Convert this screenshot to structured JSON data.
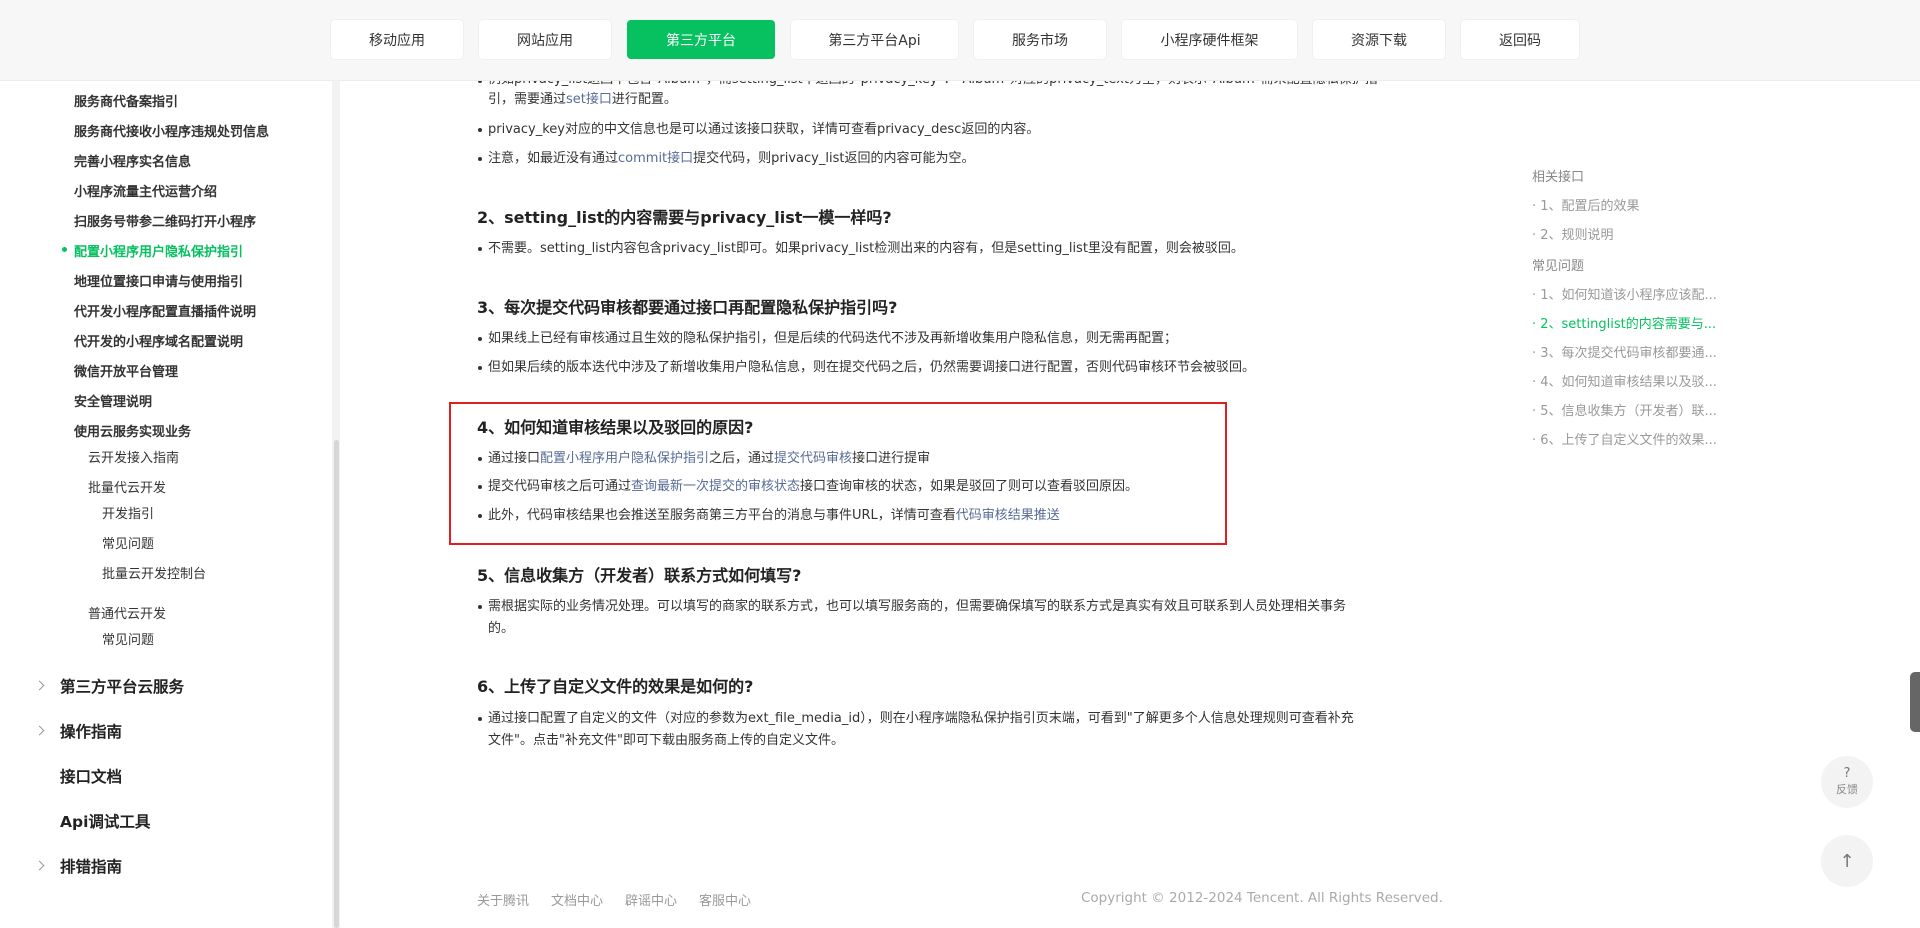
{
  "topnav": {
    "items": [
      "移动应用",
      "网站应用",
      "第三方平台",
      "第三方平台Api",
      "服务市场",
      "小程序硬件框架",
      "资源下载",
      "返回码"
    ],
    "active_index": 2
  },
  "sidebar": {
    "items": [
      "服务商代备案指引",
      "服务商代接收小程序违规处罚信息",
      "完善小程序实名信息",
      "小程序流量主代运营介绍",
      "扫服务号带参二维码打开小程序",
      "配置小程序用户隐私保护指引",
      "地理位置接口申请与使用指引",
      "代开发小程序配置直播插件说明",
      "代开发的小程序域名配置说明",
      "微信开放平台管理",
      "安全管理说明",
      "使用云服务实现业务"
    ],
    "active_item": "配置小程序用户隐私保护指引",
    "cloud_sub": {
      "access_guide": "云开发接入指南",
      "batch": "批量代云开发",
      "batch_children": [
        "开发指引",
        "常见问题",
        "批量云开发控制台"
      ],
      "normal": "普通代云开发",
      "normal_children": [
        "常见问题"
      ]
    },
    "top_sections": [
      "第三方平台云服务",
      "操作指南",
      "接口文档",
      "Api调试工具",
      "排错指南"
    ]
  },
  "content": {
    "intro_line1_a": "例如privacy_list返回中包含\"Album\"，而setting_list中返回的\"privacy_key\"：\"Album\"对应的privacy_text为空，则表示\"Album\"需未配置隐私保护指",
    "intro_line2_a": "引，需要通过",
    "intro_line2_link": "set接口",
    "intro_line2_b": "进行配置。",
    "intro_b2": "privacy_key对应的中文信息也是可以通过该接口获取，详情可查看privacy_desc返回的内容。",
    "intro_b3_a": "注意，如最近没有通过",
    "intro_b3_link": "commit接口",
    "intro_b3_b": "提交代码，则privacy_list返回的内容可能为空。",
    "q2_title": "2、setting_list的内容需要与privacy_list一模一样吗?",
    "q2_b1": "不需要。setting_list内容包含privacy_list即可。如果privacy_list检测出来的内容有，但是setting_list里没有配置，则会被驳回。",
    "q3_title": "3、每次提交代码审核都要通过接口再配置隐私保护指引吗?",
    "q3_b1": "如果线上已经有审核通过且生效的隐私保护指引，但是后续的代码迭代不涉及再新增收集用户隐私信息，则无需再配置；",
    "q3_b2": "但如果后续的版本迭代中涉及了新增收集用户隐私信息，则在提交代码之后，仍然需要调接口进行配置，否则代码审核环节会被驳回。",
    "q4_title": "4、如何知道审核结果以及驳回的原因?",
    "q4_b1_a": "通过接口",
    "q4_b1_link1": "配置小程序用户隐私保护指引",
    "q4_b1_b": "之后，通过",
    "q4_b1_link2": "提交代码审核",
    "q4_b1_c": "接口进行提审",
    "q4_b2_a": "提交代码审核之后可通过",
    "q4_b2_link": "查询最新一次提交的审核状态",
    "q4_b2_b": "接口查询审核的状态，如果是驳回了则可以查看驳回原因。",
    "q4_b3_a": "此外，代码审核结果也会推送至服务商第三方平台的消息与事件URL，详情可查看",
    "q4_b3_link": "代码审核结果推送",
    "q5_title": "5、信息收集方（开发者）联系方式如何填写?",
    "q5_b1_l1": "需根据实际的业务情况处理。可以填写的商家的联系方式，也可以填写服务商的，但需要确保填写的联系方式是真实有效且可联系到人员处理相关事务",
    "q5_b1_l2": "的。",
    "q6_title": "6、上传了自定义文件的效果是如何的?",
    "q6_b1_l1": "通过接口配置了自定义的文件（对应的参数为ext_file_media_id），则在小程序端隐私保护指引页末端，可看到\"了解更多个人信息处理规则可查看补充",
    "q6_b1_l2": "文件\"。点击\"补充文件\"即可下载由服务商上传的自定义文件。"
  },
  "toc": {
    "group1": "相关接口",
    "group1_items": [
      "· 1、配置后的效果",
      "· 2、规则说明"
    ],
    "group2": "常见问题",
    "group2_items": [
      "· 1、如何知道该小程序应该配...",
      "· 2、settinglist的内容需要与...",
      "· 3、每次提交代码审核都要通...",
      "· 4、如何知道审核结果以及驳...",
      "· 5、信息收集方（开发者）联...",
      "· 6、上传了自定义文件的效果..."
    ],
    "active_index": 1
  },
  "footer": {
    "links": [
      "关于腾讯",
      "文档中心",
      "辟谣中心",
      "客服中心"
    ],
    "copyright": "Copyright © 2012-2024 Tencent. All Rights Reserved."
  },
  "floating": {
    "feedback_q": "?",
    "feedback_label": "反馈",
    "back_top": "↑"
  },
  "colors": {
    "accent": "#07c160",
    "link": "#576b95",
    "highlight": "#e02020"
  }
}
